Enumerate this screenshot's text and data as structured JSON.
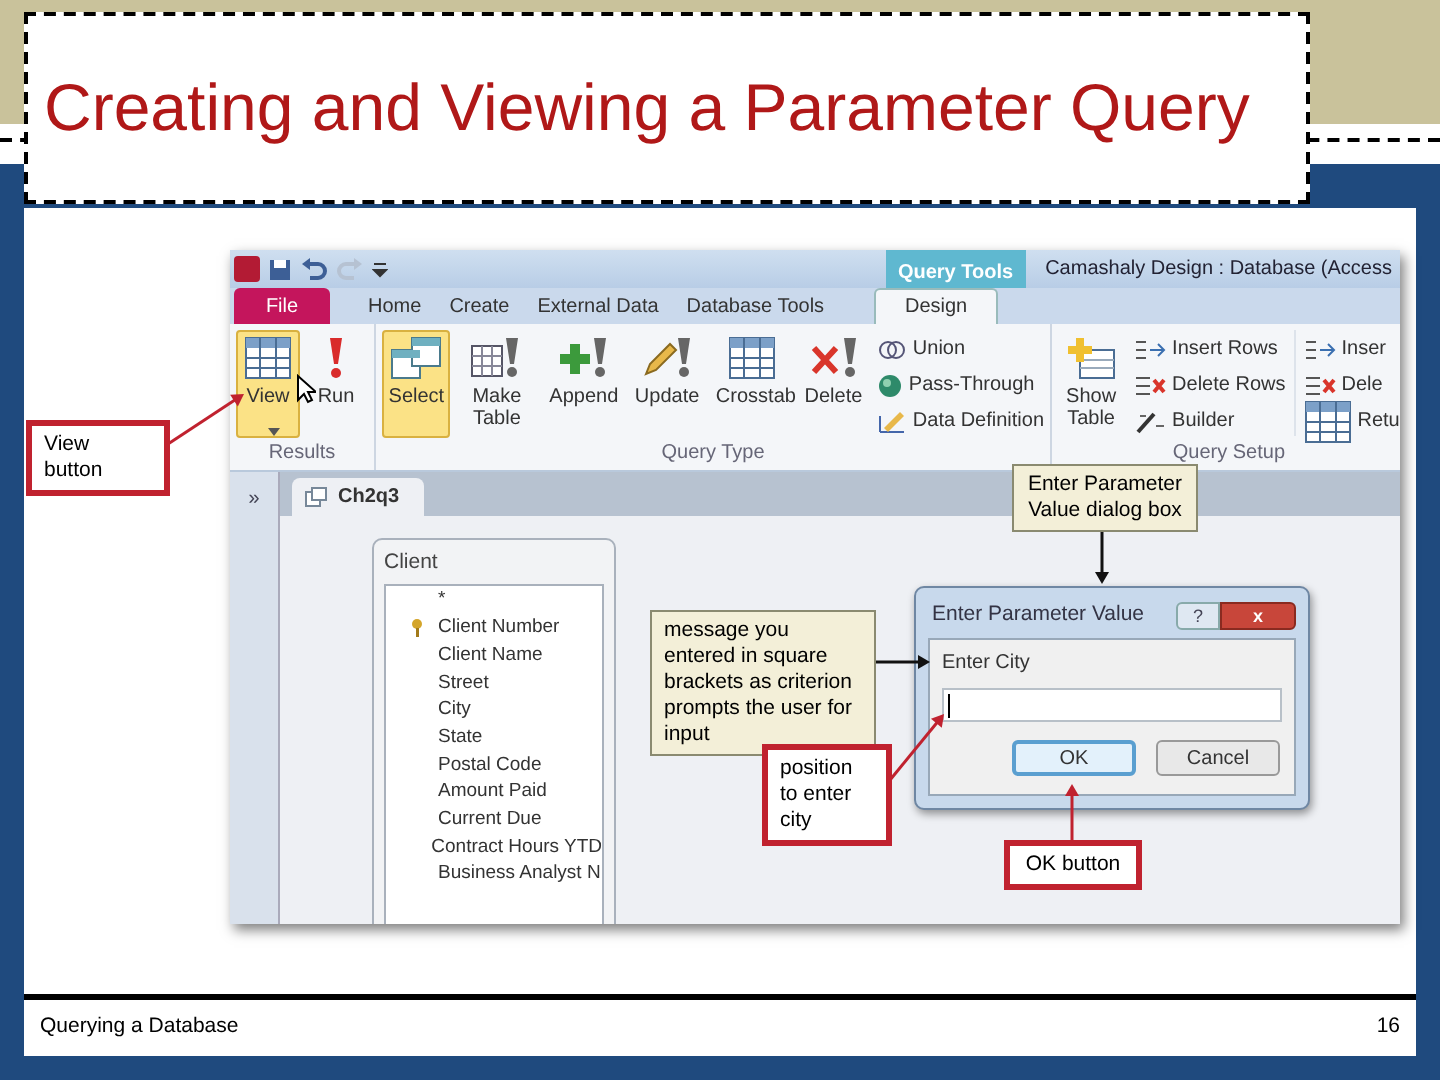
{
  "slide": {
    "title": "Creating and Viewing a Parameter Query",
    "footer_text": "Querying a Database",
    "page_number": "16"
  },
  "app": {
    "contextual_tab": "Query Tools",
    "window_title": "Camashaly Design : Database (Access",
    "tabs": [
      {
        "label": "File",
        "kind": "file",
        "selected": false
      },
      {
        "label": "Home",
        "kind": "tab",
        "selected": false
      },
      {
        "label": "Create",
        "kind": "tab",
        "selected": false
      },
      {
        "label": "External Data",
        "kind": "tab",
        "selected": false
      },
      {
        "label": "Database Tools",
        "kind": "tab",
        "selected": false
      },
      {
        "label": "Design",
        "kind": "tab",
        "selected": true
      }
    ],
    "ribbon_groups": [
      {
        "label": "Results",
        "buttons": [
          {
            "label": "View",
            "selected": true
          },
          {
            "label": "Run",
            "selected": false
          }
        ]
      },
      {
        "label": "Query Type",
        "buttons": [
          {
            "label": "Select",
            "selected": true
          },
          {
            "label": "Make Table",
            "selected": false
          },
          {
            "label": "Append",
            "selected": false
          },
          {
            "label": "Update",
            "selected": false
          },
          {
            "label": "Crosstab",
            "selected": false
          },
          {
            "label": "Delete",
            "selected": false
          }
        ],
        "small_buttons": [
          "Union",
          "Pass-Through",
          "Data Definition"
        ]
      },
      {
        "label": "Query Setup",
        "buttons": [
          {
            "label": "Show Table",
            "selected": false
          }
        ],
        "small_buttons": [
          "Insert Rows",
          "Delete Rows",
          "Builder"
        ],
        "cut_buttons": [
          "Inser",
          "Dele",
          "Retu"
        ]
      }
    ],
    "nav_toggle": "»",
    "document_tab": "Ch2q3",
    "field_list": {
      "title": "Client",
      "fields": [
        {
          "name": "*",
          "primary_key": false
        },
        {
          "name": "Client Number",
          "primary_key": true
        },
        {
          "name": "Client Name",
          "primary_key": false
        },
        {
          "name": "Street",
          "primary_key": false
        },
        {
          "name": "City",
          "primary_key": false
        },
        {
          "name": "State",
          "primary_key": false
        },
        {
          "name": "Postal Code",
          "primary_key": false
        },
        {
          "name": "Amount Paid",
          "primary_key": false
        },
        {
          "name": "Current Due",
          "primary_key": false
        },
        {
          "name": "Contract Hours YTD",
          "primary_key": false
        },
        {
          "name": "Business Analyst N",
          "primary_key": false
        }
      ]
    },
    "dialog": {
      "title": "Enter Parameter Value",
      "help": "?",
      "close": "x",
      "prompt": "Enter City",
      "buttons": [
        {
          "label": "OK",
          "selected": true
        },
        {
          "label": "Cancel",
          "selected": false
        }
      ]
    }
  },
  "callouts": [
    {
      "text": "View button",
      "kind": "red"
    },
    {
      "text": "Enter Parameter Value dialog box",
      "kind": "note"
    },
    {
      "text": "message you entered in square brackets as criterion prompts the user for input",
      "kind": "note"
    },
    {
      "text": "position to enter city",
      "kind": "red"
    },
    {
      "text": "OK button",
      "kind": "red"
    }
  ]
}
